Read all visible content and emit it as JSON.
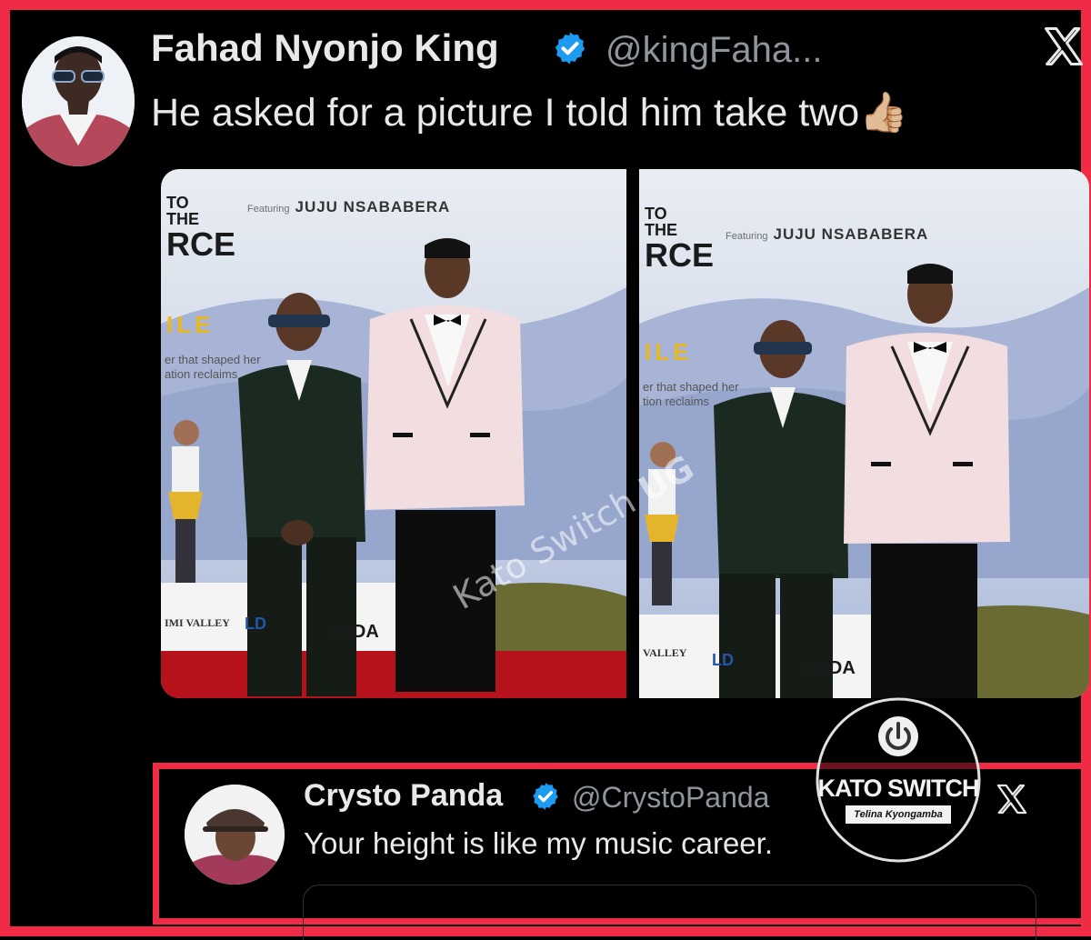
{
  "original_tweet": {
    "author_name": "Fahad Nyonjo King",
    "handle": "@kingFaha...",
    "text": "He asked for a picture I told him take two",
    "emoji": "👍🏼",
    "photos": [
      {
        "poster_title_lines": [
          "TO",
          "THE",
          "RCE"
        ],
        "poster_subtitle": "ILE",
        "featuring_label": "Featuring",
        "featuring_name": "JUJU NSABABERA",
        "tagline": "er that shaped her",
        "tagline2": "ation reclaims",
        "sponsors": [
          "IMI VALLEY",
          "LD",
          "UNDA"
        ]
      },
      {
        "poster_title_lines": [
          "TO",
          "THE",
          "RCE"
        ],
        "poster_subtitle": "ILE",
        "featuring_label": "Featuring",
        "featuring_name": "JUJU NSABABERA",
        "tagline": "er that shaped her",
        "tagline2": "tion reclaims",
        "sponsors": [
          "VALLEY",
          "LD",
          "UNDA"
        ]
      }
    ],
    "watermark": {
      "text": "Kato Switch",
      "suffix": "UG"
    }
  },
  "reply_tweet": {
    "author_name": "Crysto Panda",
    "handle": "@CrystoPanda",
    "text": "Your height is like my music career."
  },
  "badge": {
    "title": "KATO SWITCH",
    "subtitle": "Telina Kyongamba"
  },
  "icons": {
    "verified": "verified-badge-icon",
    "x_logo": "x-logo-icon",
    "power": "power-icon"
  },
  "colors": {
    "accent_red": "#ef2b45",
    "verified_blue": "#1d9bf0",
    "background": "#000000"
  }
}
